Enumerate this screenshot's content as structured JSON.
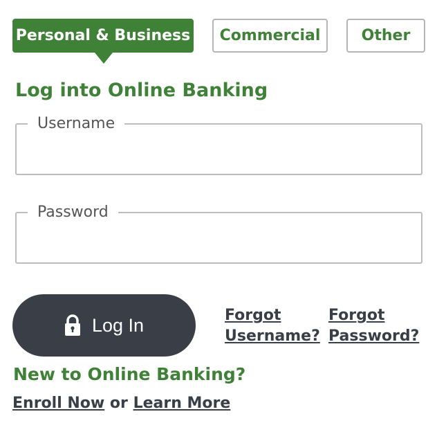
{
  "tabs": [
    {
      "label": "Personal & Business",
      "active": true
    },
    {
      "label": "Commercial",
      "active": false
    },
    {
      "label": "Other",
      "active": false
    }
  ],
  "login": {
    "heading": "Log into Online Banking",
    "username": {
      "label": "Username",
      "value": "",
      "placeholder": ""
    },
    "password": {
      "label": "Password",
      "value": "",
      "placeholder": ""
    },
    "login_button": {
      "label": "Log In",
      "icon": "lock-icon"
    },
    "forgot_username": [
      "Forgot",
      "Username?"
    ],
    "forgot_password": [
      "Forgot",
      "Password?"
    ]
  },
  "enroll": {
    "heading": "New to Online Banking?",
    "enroll_now": "Enroll Now",
    "separator": "or",
    "learn_more": "Learn More"
  },
  "colors": {
    "brand_green": "#3f8237",
    "dark_button": "#3a3f47",
    "border_gray": "#bdbdbd"
  }
}
